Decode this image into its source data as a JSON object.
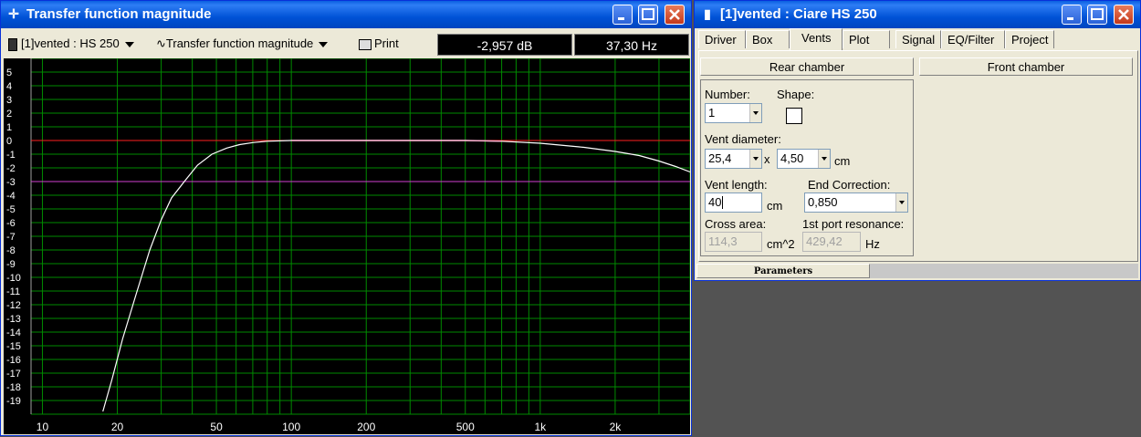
{
  "left_window": {
    "title": "Transfer function magnitude",
    "toolbar": {
      "project_select": "[1]vented : HS 250",
      "plot_select": "Transfer function magnitude",
      "print_label": "Print",
      "readout_db": "-2,957 dB",
      "readout_hz": "37,30 Hz"
    }
  },
  "right_window": {
    "title": "[1]vented : Ciare HS 250",
    "tabs": [
      "Driver",
      "Box",
      "Vents",
      "Plot",
      "Signal",
      "EQ/Filter",
      "Project"
    ],
    "active_tab": "Vents",
    "rear_chamber_label": "Rear chamber",
    "front_chamber_label": "Front chamber",
    "number_label": "Number:",
    "number_value": "1",
    "shape_label": "Shape:",
    "vent_diameter_label": "Vent diameter:",
    "vent_diameter_1": "25,4",
    "times_symbol": "x",
    "vent_diameter_2": "4,50",
    "unit_cm": "cm",
    "vent_length_label": "Vent length:",
    "vent_length_value": "40",
    "unit_cm_2": "cm",
    "end_correction_label": "End Correction:",
    "end_correction_value": "0,850",
    "cross_area_label": "Cross area:",
    "cross_area_value": "114,3",
    "cross_area_unit": "cm^2",
    "port_res_label": "1st port resonance:",
    "port_res_value": "429,42",
    "port_res_unit": "Hz",
    "status_tab": "Parameters"
  },
  "chart_data": {
    "type": "line",
    "title": "",
    "xlabel": "",
    "ylabel": "",
    "x_scale": "log",
    "xlim": [
      9,
      4000
    ],
    "ylim": [
      -20,
      6
    ],
    "y_ticks": [
      5,
      4,
      3,
      2,
      1,
      0,
      -1,
      -2,
      -3,
      -4,
      -5,
      -6,
      -7,
      -8,
      -9,
      -10,
      -11,
      -12,
      -13,
      -14,
      -15,
      -16,
      -17,
      -18,
      -19
    ],
    "x_tick_labels": [
      {
        "x": 10,
        "label": "10"
      },
      {
        "x": 20,
        "label": "20"
      },
      {
        "x": 50,
        "label": "50"
      },
      {
        "x": 100,
        "label": "100"
      },
      {
        "x": 200,
        "label": "200"
      },
      {
        "x": 500,
        "label": "500"
      },
      {
        "x": 1000,
        "label": "1k"
      },
      {
        "x": 2000,
        "label": "2k"
      }
    ],
    "reference_lines": [
      {
        "y": 0,
        "color": "#ff2020"
      },
      {
        "y": -3,
        "color": "#d040d0"
      }
    ],
    "grid": true,
    "colors": {
      "background": "#000000",
      "grid": "#008a00",
      "curve": "#ffffff",
      "passband_highlight": "#ffb0d0"
    },
    "series": [
      {
        "x": [
          17.5,
          19,
          21,
          24,
          27,
          30,
          33,
          37.3,
          42,
          48,
          55,
          62,
          70,
          80,
          100,
          150,
          200,
          300,
          500,
          700,
          1000,
          1500,
          2000,
          2500,
          3000,
          3500,
          4000
        ],
        "y": [
          -19.8,
          -17.5,
          -14.5,
          -11.0,
          -8.0,
          -5.8,
          -4.2,
          -2.957,
          -1.8,
          -1.0,
          -0.55,
          -0.3,
          -0.15,
          -0.05,
          0,
          0,
          0,
          0,
          0,
          -0.05,
          -0.2,
          -0.5,
          -0.8,
          -1.1,
          -1.5,
          -1.9,
          -2.3
        ]
      }
    ]
  }
}
